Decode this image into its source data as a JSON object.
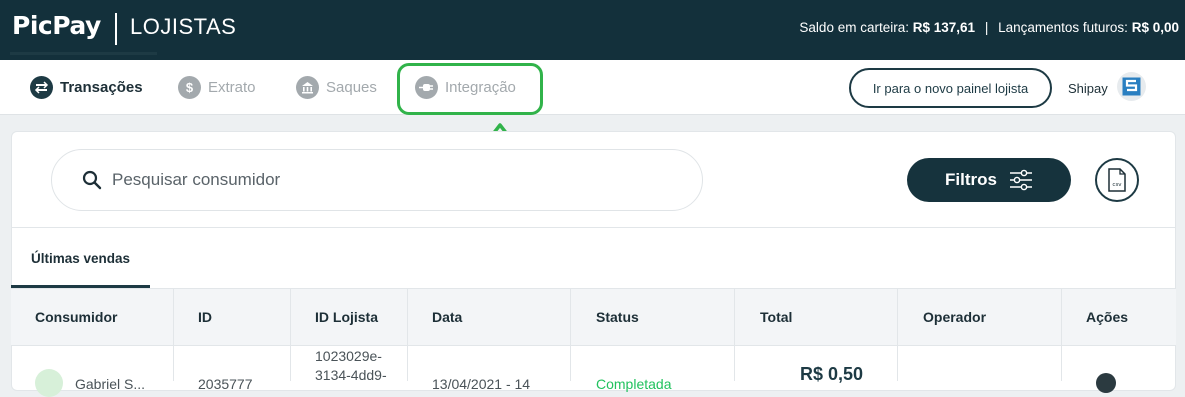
{
  "header": {
    "logo": "PicPay",
    "product": "LOJISTAS",
    "wallet_label": "Saldo em carteira:",
    "wallet_value": "R$ 137,61",
    "separator": "|",
    "future_label": "Lançamentos futuros:",
    "future_value": "R$ 0,00"
  },
  "tabs": [
    {
      "label": "Transações",
      "icon": "transactions-icon",
      "active": true
    },
    {
      "label": "Extrato",
      "icon": "dollar-icon",
      "active": false
    },
    {
      "label": "Saques",
      "icon": "bank-icon",
      "active": false
    },
    {
      "label": "Integração",
      "icon": "plug-icon",
      "active": false
    }
  ],
  "new_panel_button": "Ir para o novo painel lojista",
  "account": {
    "name": "Shipay",
    "logo_icon": "shipay-logo-icon"
  },
  "search": {
    "placeholder": "Pesquisar consumidor"
  },
  "filters_button": "Filtros",
  "csv_button": {
    "icon": "csv-file-icon",
    "label": "csv"
  },
  "subtab": "Últimas vendas",
  "table": {
    "columns": [
      "Consumidor",
      "ID",
      "ID Lojista",
      "Data",
      "Status",
      "Total",
      "Operador",
      "Ações"
    ],
    "rows": [
      {
        "consumer": "Gabriel S...",
        "id": "2035777",
        "store_id_lines": [
          "1023029e-",
          "3134-4dd9-"
        ],
        "date": "13/04/2021 - 14",
        "status": "Completada",
        "total": "R$ 0,50",
        "operator": "",
        "action_icon": "more-icon"
      }
    ]
  },
  "colors": {
    "header_bg": "#13303b",
    "accent": "#1d3a44",
    "highlight": "#31b34a",
    "status_ok": "#21c25e"
  }
}
